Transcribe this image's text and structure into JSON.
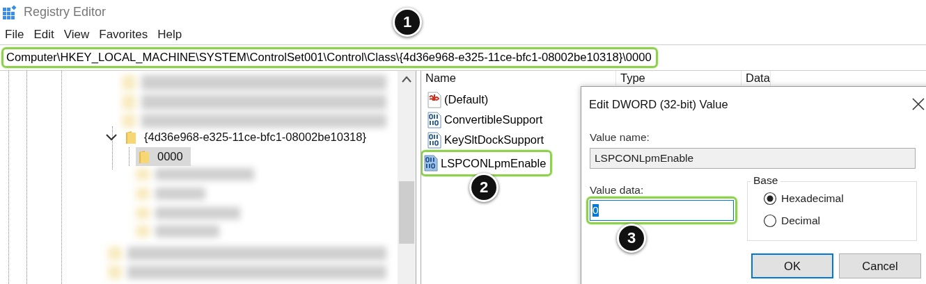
{
  "window": {
    "title": "Registry Editor"
  },
  "menu": [
    "File",
    "Edit",
    "View",
    "Favorites",
    "Help"
  ],
  "address_bar": {
    "path": "Computer\\HKEY_LOCAL_MACHINE\\SYSTEM\\ControlSet001\\Control\\Class\\{4d36e968-e325-11ce-bfc1-08002be10318}\\0000",
    "highlighted": true
  },
  "tree": {
    "items": [
      {
        "label": "{4d36e968-e325-11ce-bfc1-08002be10318}",
        "expanded": true,
        "selected": false,
        "children": [
          {
            "label": "0000",
            "selected": true
          }
        ]
      }
    ]
  },
  "values": {
    "columns": [
      "Name",
      "Type",
      "Data"
    ],
    "rows": [
      {
        "name": "(Default)",
        "kind": "string",
        "highlighted": false
      },
      {
        "name": "ConvertibleSupport",
        "kind": "dword",
        "highlighted": false
      },
      {
        "name": "KeySltDockSupport",
        "kind": "dword",
        "highlighted": false
      },
      {
        "name": "LSPCONLpmEnable",
        "kind": "dword",
        "highlighted": true
      }
    ]
  },
  "dialog": {
    "title": "Edit DWORD (32-bit) Value",
    "value_name_label": "Value name:",
    "value_name": "LSPCONLpmEnable",
    "value_data_label": "Value data:",
    "value_data": "0",
    "value_data_highlighted": true,
    "base_label": "Base",
    "bases": [
      {
        "label": "Hexadecimal",
        "selected": true
      },
      {
        "label": "Decimal",
        "selected": false
      }
    ],
    "buttons": [
      {
        "label": "OK",
        "default": true
      },
      {
        "label": "Cancel",
        "default": false
      }
    ]
  },
  "callouts": [
    "1",
    "2",
    "3"
  ]
}
